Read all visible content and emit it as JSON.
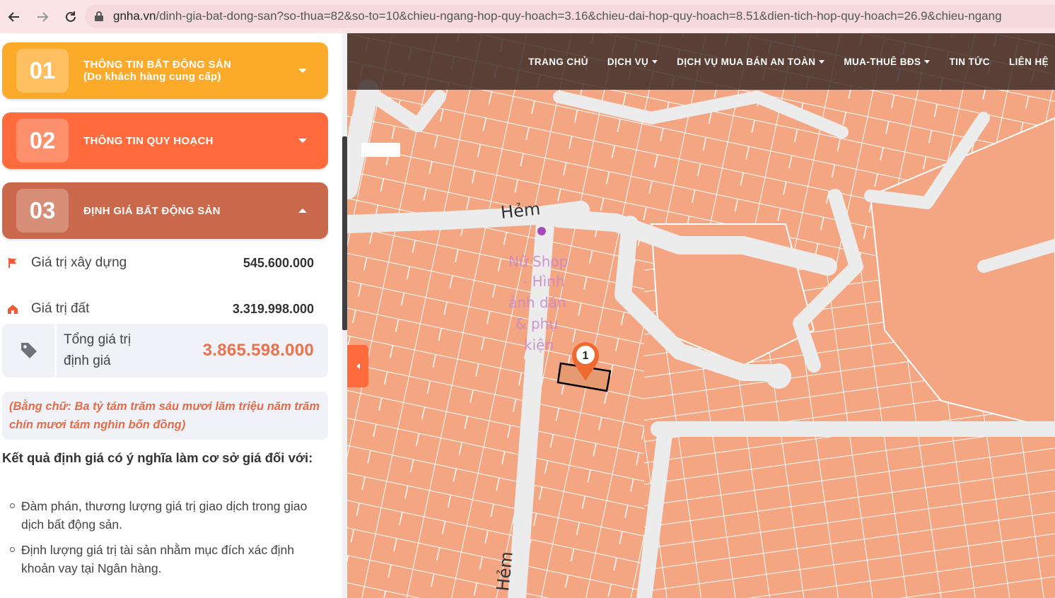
{
  "browser": {
    "url_host": "gnha.vn",
    "url_path": "/dinh-gia-bat-dong-san?so-thua=82&so-to=10&chieu-ngang-hop-quy-hoach=3.16&chieu-dai-hop-quy-hoach=8.51&dien-tich-hop-quy-hoach=26.9&chieu-ngang"
  },
  "accordion": [
    {
      "num": "01",
      "title": "THÔNG TIN BẤT ĐỘNG SẢN",
      "subtitle": "(Do khách hàng cung cấp)",
      "expanded": false
    },
    {
      "num": "02",
      "title": "THÔNG TIN QUY HOẠCH",
      "expanded": false
    },
    {
      "num": "03",
      "title": "ĐỊNH GIÁ BẤT ĐỘNG SẢN",
      "expanded": true
    }
  ],
  "valuation": {
    "build_label": "Giá trị xây dựng",
    "build_value": "545.600.000",
    "land_label": "Giá trị đất",
    "land_value": "3.319.998.000",
    "total_label": "Tổng giá trị định giá",
    "total_value": "3.865.598.000",
    "in_words": "(Bằng chữ: Ba tỷ tám trăm sáu mươi lăm triệu năm trăm chín mươi tám nghìn bốn đồng)"
  },
  "meaning": {
    "heading": "Kết quả định giá có ý nghĩa làm cơ sở giá đối với:",
    "items": [
      "Đàm phán, thương lượng giá trị giao dịch trong giao dịch bất động sản.",
      "Định lượng giá trị tài sản nhằm mục đích xác định khoản vay tại Ngân hàng."
    ]
  },
  "nav": {
    "home": "TRANG CHỦ",
    "services": "DỊCH VỤ",
    "safe_trade": "DỊCH VỤ MUA BÁN AN TOÀN",
    "buy_rent": "MUA-THUÊ BĐS",
    "news": "TIN TỨC",
    "contact": "LIÊN HỆ"
  },
  "map": {
    "street_top": "Hẻm",
    "street_bottom": "Hẻm",
    "poi": "Nữ Shop - Hình ảnh dán & phụ kiện",
    "marker_label": "1"
  },
  "colors": {
    "card1": "#fcaa2a",
    "card2": "#ff6b3d",
    "card3": "#c9684a",
    "parcel": "#f4a582",
    "total_value": "#e7734f"
  }
}
